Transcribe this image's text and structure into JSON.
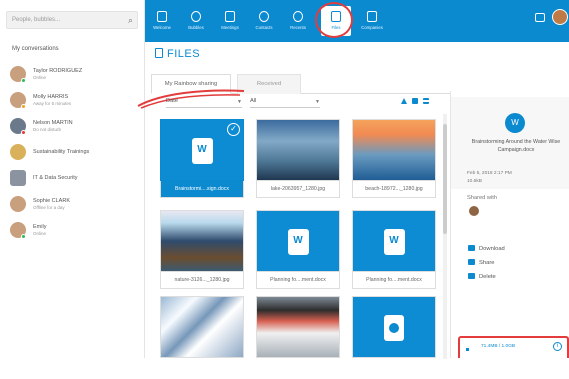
{
  "search": {
    "placeholder": "People, bubbles..."
  },
  "sidebar": {
    "title": "My conversations",
    "contacts": [
      {
        "name": "Taylor RODRIGUEZ",
        "status": "Online"
      },
      {
        "name": "Molly HARRIS",
        "status": "Away for 5 minutes"
      },
      {
        "name": "Nelson MARTIN",
        "status": "Do not disturb"
      },
      {
        "name": "Sustainability Trainings",
        "status": ""
      },
      {
        "name": "IT & Data Security",
        "status": ""
      },
      {
        "name": "Sophie CLARK",
        "status": "Offline for a day"
      },
      {
        "name": "Emily",
        "status": "Online"
      }
    ]
  },
  "nav": {
    "items": [
      "Welcome",
      "Bubbles",
      "Meetings",
      "Contacts",
      "Recents",
      "Files",
      "Companies"
    ]
  },
  "page": {
    "title": "FILES"
  },
  "tabs": [
    "My Rainbow sharing",
    "Received"
  ],
  "filters": {
    "date": "Date",
    "all": "All"
  },
  "files": [
    {
      "name": "Brainstormi....sign.docx",
      "selected": true
    },
    {
      "name": "lake-2063957_1280.jpg"
    },
    {
      "name": "beach-18972..._1280.jpg"
    },
    {
      "name": "nature-3126..._1280.jpg"
    },
    {
      "name": "Planning fo....ment.docx"
    },
    {
      "name": "Planning fo....ment.docx"
    },
    {
      "name": "",
      "image": "snow"
    },
    {
      "name": "",
      "image": "machine"
    },
    {
      "name": "",
      "type": "video"
    }
  ],
  "detail": {
    "doc_icon": "W",
    "title": "Brainstorming Around the Water Wise Campaign.docx",
    "date": "Feb 5, 2018 2:17 PM",
    "size": "10.6kB",
    "shared_with": "Shared with",
    "download": "Download",
    "share": "Share",
    "delete": "Delete"
  },
  "storage": {
    "text": "71.4MB / 1.0GB",
    "info": "i"
  }
}
